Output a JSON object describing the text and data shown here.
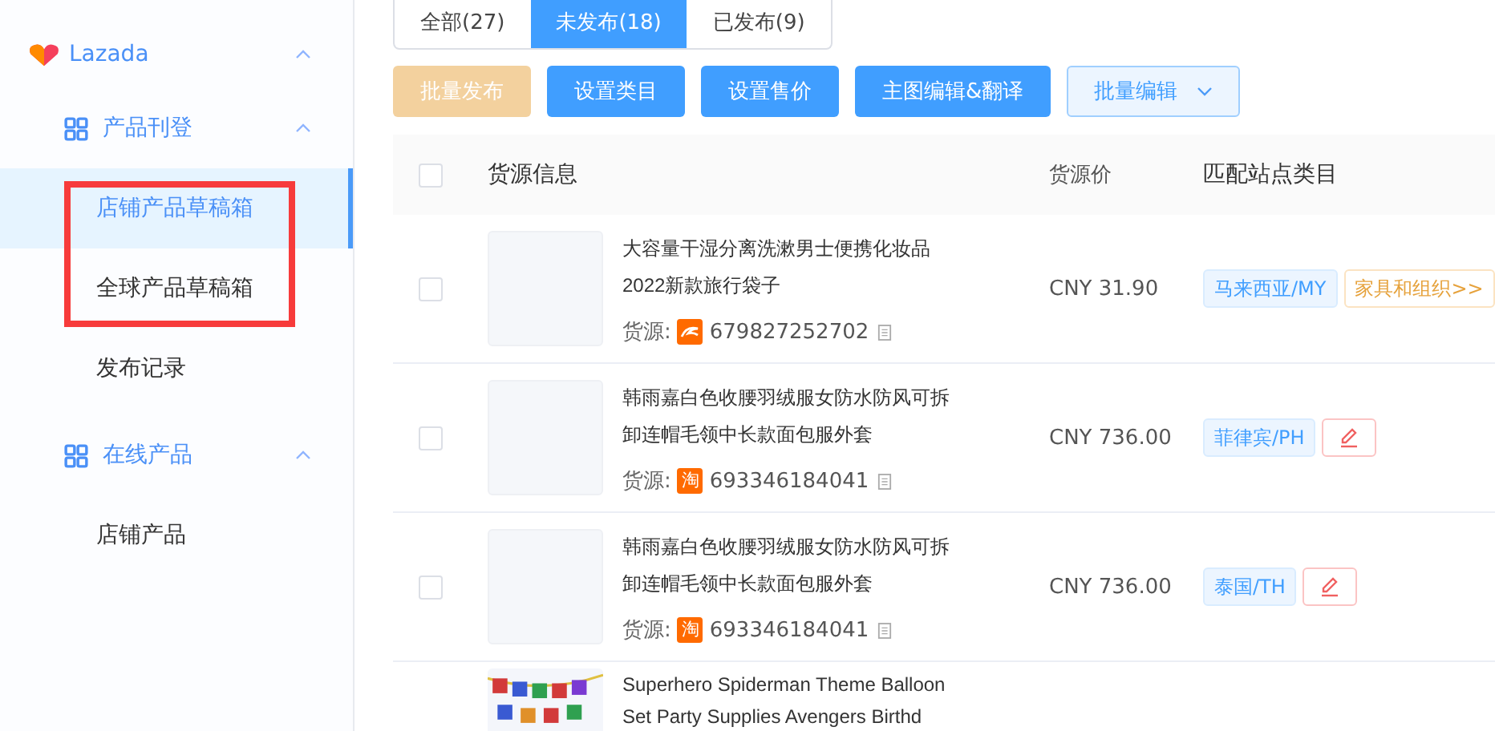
{
  "sidebar": {
    "brand": "Lazada",
    "brand_expanded": true,
    "groups": [
      {
        "label": "产品刊登",
        "expanded": true,
        "items": [
          {
            "label": "店铺产品草稿箱",
            "selected": true,
            "highlighted": true
          },
          {
            "label": "全球产品草稿箱",
            "selected": false,
            "highlighted": true
          },
          {
            "label": "发布记录",
            "selected": false,
            "highlighted": false
          }
        ]
      },
      {
        "label": "在线产品",
        "expanded": true,
        "items": [
          {
            "label": "店铺产品",
            "selected": false,
            "highlighted": false
          }
        ]
      }
    ]
  },
  "tabs": [
    {
      "label": "全部(27)",
      "selected": false
    },
    {
      "label": "未发布(18)",
      "selected": true
    },
    {
      "label": "已发布(9)",
      "selected": false
    }
  ],
  "actions": [
    {
      "label": "批量发布",
      "kind": "warning",
      "disabled": true
    },
    {
      "label": "设置类目",
      "kind": "primary",
      "disabled": false
    },
    {
      "label": "设置售价",
      "kind": "primary",
      "disabled": false
    },
    {
      "label": "主图编辑&翻译",
      "kind": "primary",
      "disabled": false
    },
    {
      "label": "批量编辑",
      "kind": "dropdown",
      "disabled": false
    }
  ],
  "table": {
    "columns": [
      "货源信息",
      "货源价",
      "匹配站点类目"
    ],
    "select_all": false,
    "rows": [
      {
        "checked": false,
        "image": {
          "kind": "placeholder"
        },
        "title": "大容量干湿分离洗漱男士便携化妆品2022新款旅行袋子",
        "source_label": "货源:",
        "source": {
          "kind": "alibaba"
        },
        "source_id": "679827252702",
        "price": "CNY 31.90",
        "site": "马来西亚/MY",
        "category": "家具和组织>>"
      },
      {
        "checked": false,
        "image": {
          "kind": "placeholder"
        },
        "title": "韩雨嘉白色收腰羽绒服女防水防风可拆卸连帽毛领中长款面包服外套",
        "source_label": "货源:",
        "source": {
          "kind": "taobao",
          "glyph": "淘"
        },
        "source_id": "693346184041",
        "price": "CNY 736.00",
        "site": "菲律宾/PH",
        "editable": true
      },
      {
        "checked": false,
        "image": {
          "kind": "placeholder"
        },
        "title": "韩雨嘉白色收腰羽绒服女防水防风可拆卸连帽毛领中长款面包服外套",
        "source_label": "货源:",
        "source": {
          "kind": "taobao",
          "glyph": "淘"
        },
        "source_id": "693346184041",
        "price": "CNY 736.00",
        "site": "泰国/TH",
        "editable": true
      },
      {
        "title": "Superhero Spiderman Theme Balloon Set Party Supplies Avengers Birthd"
      }
    ]
  }
}
